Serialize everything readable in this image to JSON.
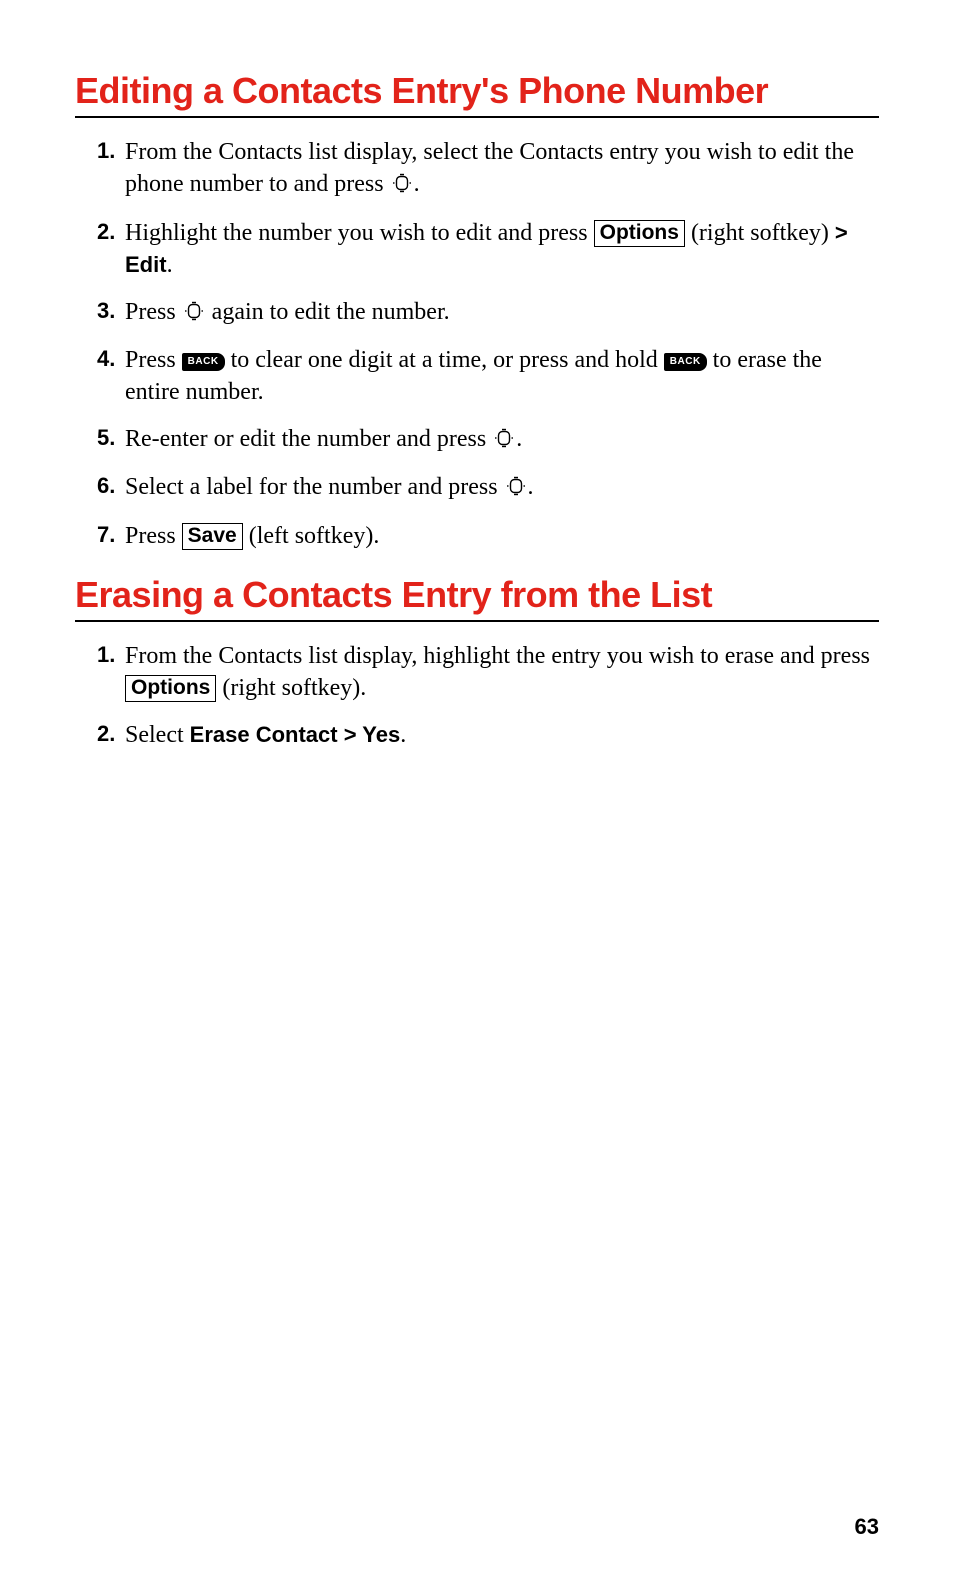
{
  "section1": {
    "title": "Editing a Contacts Entry's Phone Number",
    "steps": {
      "s1a": "From the Contacts list display, select the Contacts entry you wish to edit the phone number to and press ",
      "s1b": ".",
      "s2a": "Highlight the number you wish to edit and press ",
      "s2_opt": "Options",
      "s2b": " (right softkey) ",
      "s2_bold": "> Edit",
      "s2c": ".",
      "s3a": "Press ",
      "s3b": " again to edit the number.",
      "s4a": "Press ",
      "s4_back1": "BACK",
      "s4b": " to clear one digit at a time, or press and hold ",
      "s4_back2": "BACK",
      "s4c": " to erase the entire number.",
      "s5a": "Re-enter or edit the number and press ",
      "s5b": ".",
      "s6a": "Select a label for the number and press ",
      "s6b": ".",
      "s7a": "Press ",
      "s7_save": "Save",
      "s7b": " (left softkey)."
    },
    "nums": {
      "n1": "1.",
      "n2": "2.",
      "n3": "3.",
      "n4": "4.",
      "n5": "5.",
      "n6": "6.",
      "n7": "7."
    }
  },
  "section2": {
    "title": "Erasing a Contacts Entry from the List",
    "steps": {
      "s1a": "From the Contacts list display, highlight the entry you wish to erase and press ",
      "s1_opt": "Options",
      "s1b": " (right softkey).",
      "s2a": "Select ",
      "s2_bold": "Erase Contact > Yes",
      "s2b": "."
    },
    "nums": {
      "n1": "1.",
      "n2": "2."
    }
  },
  "page_number": "63"
}
